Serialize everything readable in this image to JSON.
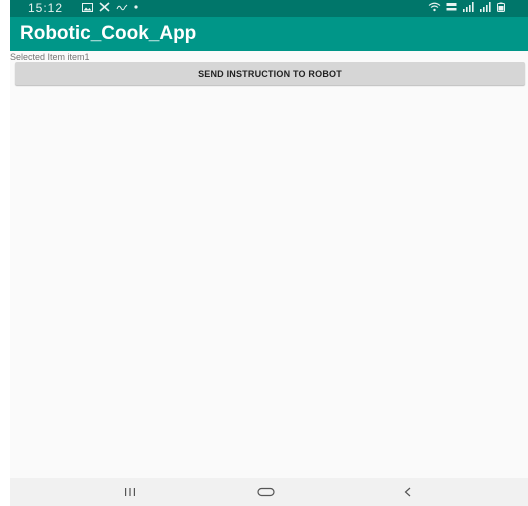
{
  "status_bar": {
    "time": "15:12",
    "icons_left": [
      "gallery-icon",
      "tools-icon",
      "data-icon",
      "dot-icon"
    ],
    "icons_right": [
      "wifi-icon",
      "volte-icon",
      "signal-icon",
      "signal-icon",
      "battery-icon"
    ]
  },
  "app_bar": {
    "title": "Robotic_Cook_App",
    "color": "#009688"
  },
  "main": {
    "selected_text": "Selected Item item1",
    "send_button_label": "SEND INSTRUCTION TO ROBOT"
  },
  "nav_bar": {
    "buttons": [
      "recent-apps-icon",
      "home-icon",
      "back-icon"
    ]
  }
}
